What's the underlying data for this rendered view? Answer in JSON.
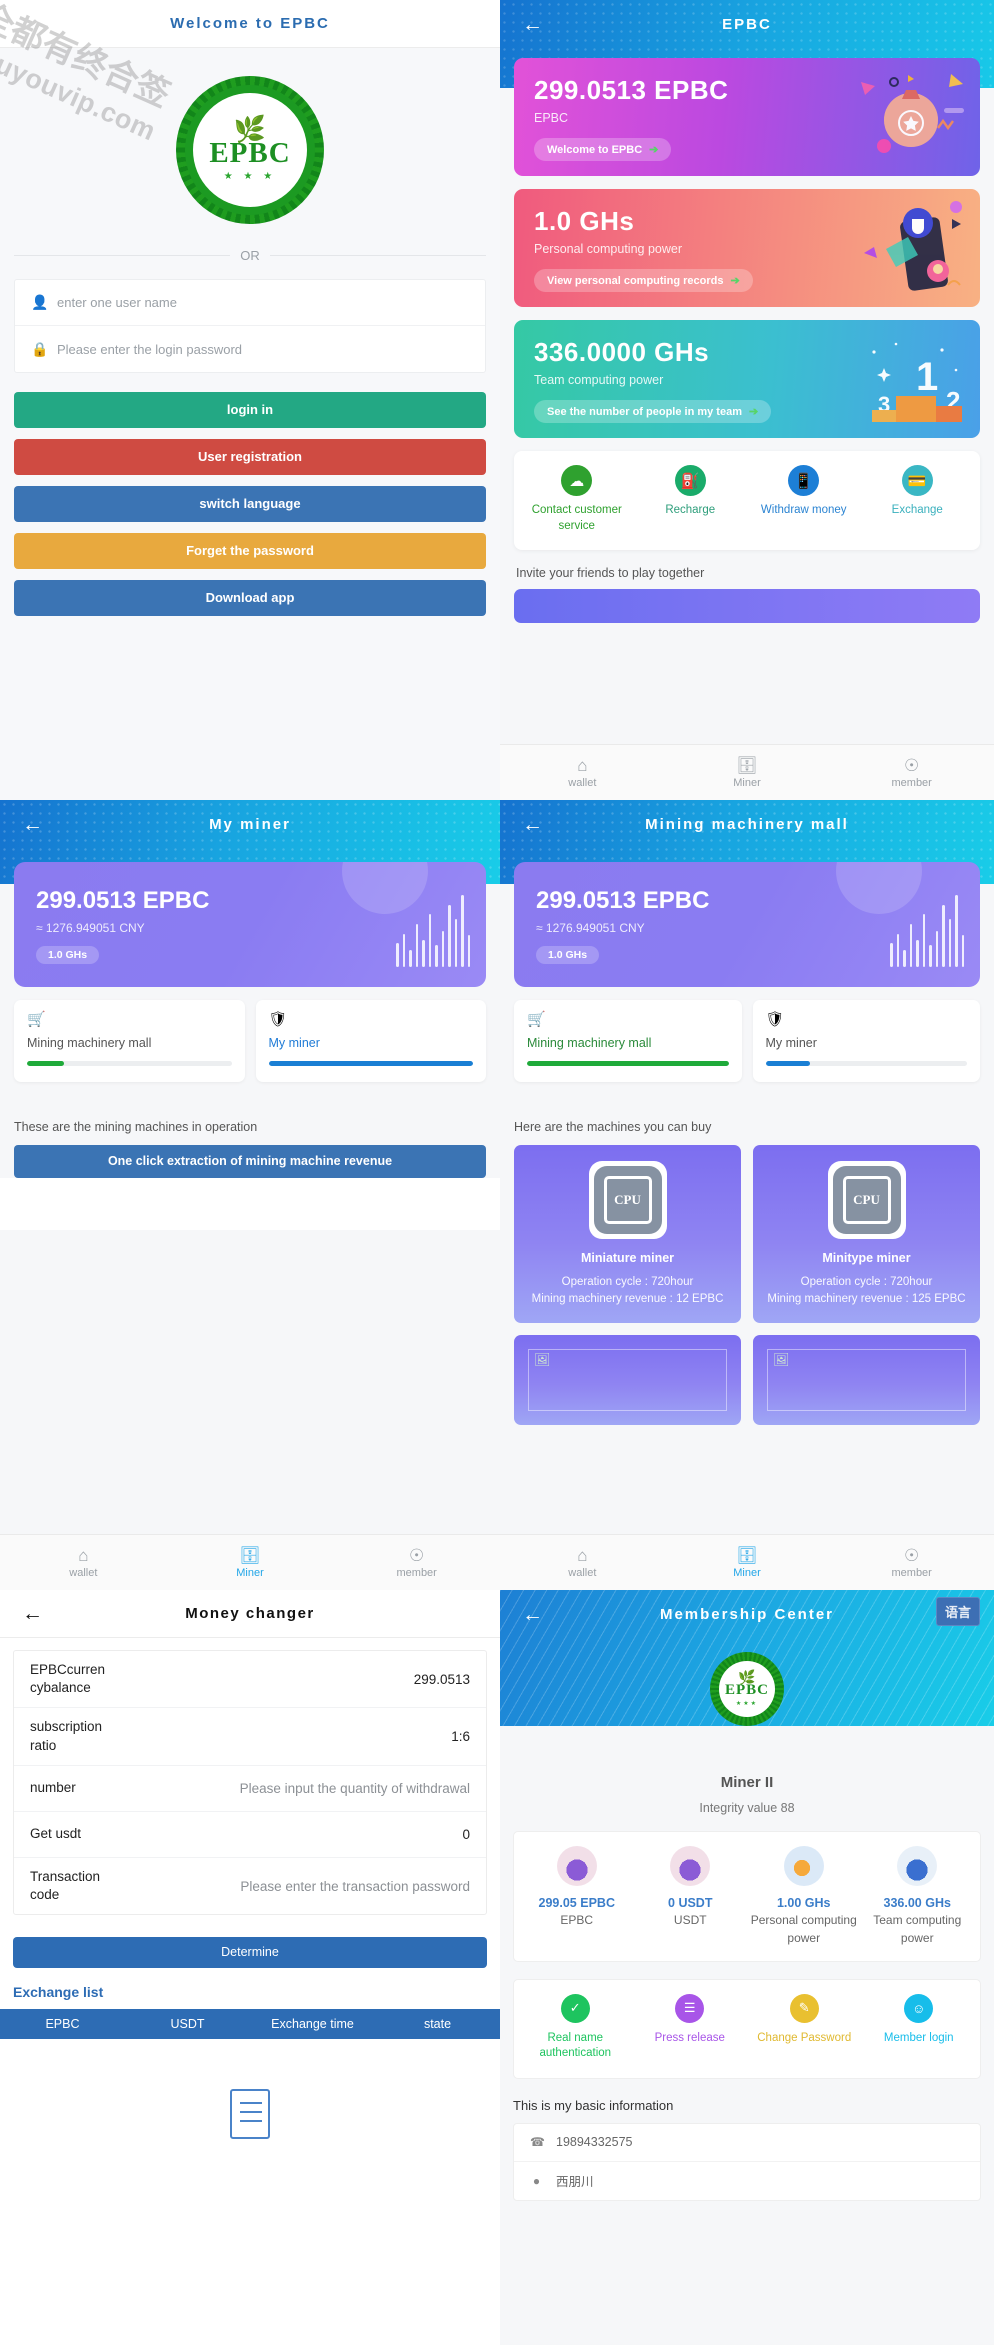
{
  "watermark": {
    "line1": "全都有终合签",
    "line2": "douyouvip.com"
  },
  "login": {
    "header_title": "Welcome to EPBC",
    "logo": {
      "text": "EPBC",
      "leaf_icon": "leaf-icon",
      "stars": "★ ★ ★"
    },
    "divider_label": "OR",
    "username": {
      "placeholder": "enter one user name",
      "value": "",
      "icon": "user-icon"
    },
    "password": {
      "placeholder": "Please enter the login password",
      "value": "",
      "icon": "lock-icon"
    },
    "buttons": [
      {
        "label": "login in",
        "color": "#23a884",
        "name": "login-button"
      },
      {
        "label": "User registration",
        "color": "#cf4b42",
        "name": "user-registration-button"
      },
      {
        "label": "switch language",
        "color": "#3b74b4",
        "name": "switch-language-button"
      },
      {
        "label": "Forget the password",
        "color": "#e8a93e",
        "name": "forget-password-button"
      },
      {
        "label": "Download app",
        "color": "#3b74b4",
        "name": "download-app-button"
      }
    ]
  },
  "wallet": {
    "header_title": "EPBC",
    "back_icon": "back-arrow-icon",
    "cards": [
      {
        "value": "299.0513 EPBC",
        "label": "EPBC",
        "action": "Welcome to EPBC",
        "accent": "#e252d8",
        "deco": "coin-bag-icon"
      },
      {
        "value": "1.0 GHs",
        "label": "Personal computing power",
        "action": "View personal computing records",
        "accent": "#f05a7e",
        "deco": "phone-hand-icon"
      },
      {
        "value": "336.0000 GHs",
        "label": "Team computing power",
        "action": "See the number of people in my team",
        "accent": "#35c9a4",
        "deco": "podium-icon"
      }
    ],
    "services": [
      {
        "label": "Contact customer service",
        "icon": "headset-icon",
        "color": "#2fa12f",
        "text_color": "#2fa12f"
      },
      {
        "label": "Recharge",
        "icon": "fuel-pump-icon",
        "color": "#1aab6a",
        "text_color": "#2e9e7b"
      },
      {
        "label": "Withdraw money",
        "icon": "phone-icon",
        "color": "#1d7fd6",
        "text_color": "#2b84d2"
      },
      {
        "label": "Exchange",
        "icon": "wallet-icon",
        "color": "#3ab7c4",
        "text_color": "#3ab0bd"
      }
    ],
    "invite_text": "Invite your friends to play together",
    "tabs": [
      {
        "label": "wallet",
        "icon": "home-icon",
        "active": false
      },
      {
        "label": "Miner",
        "icon": "server-icon",
        "active": true
      },
      {
        "label": "member",
        "icon": "account-icon",
        "active": false
      }
    ]
  },
  "my_miner": {
    "header_title": "My miner",
    "balance": "299.0513 EPBC",
    "cny": "≈ 1276.949051 CNY",
    "ghs_badge": "1.0 GHs",
    "tabs": [
      {
        "label": "Mining machinery mall",
        "icon": "cart-icon",
        "progress": 18,
        "bar_color": "#1faa3a",
        "selected": false
      },
      {
        "label": "My miner",
        "icon": "shield-icon",
        "progress": 100,
        "bar_color": "#1a7fd4",
        "selected": true
      }
    ],
    "hint": "These are the mining machines in operation",
    "extract_button": "One click extraction of mining machine revenue",
    "tabs_bottom": [
      {
        "label": "wallet",
        "icon": "home-icon",
        "active": false
      },
      {
        "label": "Miner",
        "icon": "server-icon",
        "active": true
      },
      {
        "label": "member",
        "icon": "account-icon",
        "active": false
      }
    ]
  },
  "mall": {
    "header_title": "Mining machinery mall",
    "balance": "299.0513 EPBC",
    "cny": "≈ 1276.949051 CNY",
    "ghs_badge": "1.0 GHs",
    "tabs": [
      {
        "label": "Mining machinery mall",
        "icon": "cart-icon",
        "progress": 100,
        "bar_color": "#1faa3a",
        "selected": true
      },
      {
        "label": "My miner",
        "icon": "shield-icon",
        "progress": 22,
        "bar_color": "#1a7fd4",
        "selected": false
      }
    ],
    "hint": "Here are the machines you can buy",
    "items": [
      {
        "name": "Miniature miner",
        "cycle": "Operation cycle : 720hour",
        "revenue": "Mining machinery revenue : 12 EPBC",
        "thumb": "cpu-icon"
      },
      {
        "name": "Minitype miner",
        "cycle": "Operation cycle : 720hour",
        "revenue": "Mining machinery revenue : 125 EPBC",
        "thumb": "cpu-icon"
      },
      {
        "name": "",
        "cycle": "",
        "revenue": "",
        "thumb": "broken-image-icon"
      },
      {
        "name": "",
        "cycle": "",
        "revenue": "",
        "thumb": "broken-image-icon"
      }
    ],
    "tabs_bottom": [
      {
        "label": "wallet",
        "icon": "home-icon",
        "active": false
      },
      {
        "label": "Miner",
        "icon": "server-icon",
        "active": true
      },
      {
        "label": "member",
        "icon": "account-icon",
        "active": false
      }
    ]
  },
  "money_changer": {
    "header_title": "Money changer",
    "rows": [
      {
        "label": "EPBCcurren cybalance",
        "value": "299.0513",
        "type": "text"
      },
      {
        "label": "subscription ratio",
        "value": "1:6",
        "type": "text"
      },
      {
        "label": "number",
        "placeholder": "Please input the quantity of withdrawal",
        "value": "",
        "type": "input"
      },
      {
        "label": "Get usdt",
        "value": "0",
        "type": "text"
      },
      {
        "label": "Transaction code",
        "placeholder": "Please enter the transaction password",
        "value": "",
        "type": "input"
      }
    ],
    "determine_button": "Determine",
    "exchange_list_title": "Exchange list",
    "table_headers": [
      "EPBC",
      "USDT",
      "Exchange time",
      "state"
    ],
    "table_rows": [],
    "empty_icon": "document-empty-icon"
  },
  "membership": {
    "header_title": "Membership Center",
    "language_button": "语言",
    "seal_text": "EPBC",
    "member_name": "Miner II",
    "integrity": "Integrity value 88",
    "stats": [
      {
        "value": "299.05 EPBC",
        "label": "EPBC",
        "icon": "person-coins-icon"
      },
      {
        "value": "0 USDT",
        "label": "USDT",
        "icon": "person-coins-icon"
      },
      {
        "value": "1.00 GHs",
        "label": "Personal computing power",
        "icon": "hand-phone-icon"
      },
      {
        "value": "336.00 GHs",
        "label": "Team computing power",
        "icon": "person-network-icon"
      }
    ],
    "actions": [
      {
        "label": "Real name authentication",
        "icon": "shield-check-icon",
        "color": "#1ec45f",
        "text_color": "#1ec45f"
      },
      {
        "label": "Press release",
        "icon": "document-icon",
        "color": "#a855e8",
        "text_color": "#a855e8"
      },
      {
        "label": "Change Password",
        "icon": "pencil-icon",
        "color": "#e9c030",
        "text_color": "#e0b930"
      },
      {
        "label": "Member login",
        "icon": "face-icon",
        "color": "#17bdea",
        "text_color": "#17bdea"
      }
    ],
    "basic_title": "This is my basic information",
    "basic_rows": [
      {
        "icon": "phone-icon",
        "value": "19894332575"
      },
      {
        "icon": "location-icon",
        "value": "西朋川"
      }
    ]
  }
}
